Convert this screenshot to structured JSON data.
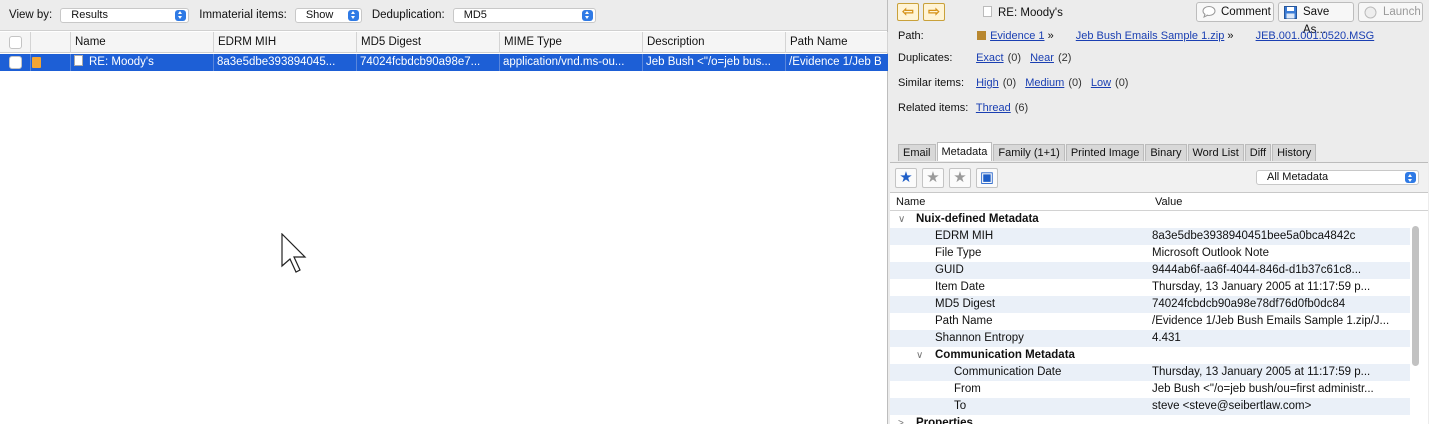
{
  "toolbar": {
    "view_by_label": "View by:",
    "view_by_value": "Results",
    "immaterial_label": "Immaterial items:",
    "immaterial_value": "Show",
    "dedup_label": "Deduplication:",
    "dedup_value": "MD5"
  },
  "results": {
    "columns": [
      "Name",
      "EDRM MIH",
      "MD5 Digest",
      "MIME Type",
      "Description",
      "Path Name"
    ],
    "row": {
      "name": "RE: Moody's",
      "edrm_mih": "8a3e5dbe393894045...",
      "md5": "74024fcbdcb90a98e7...",
      "mime": "application/vnd.ms-ou...",
      "description": "Jeb Bush <\"/o=jeb bus...",
      "path": "/Evidence 1/Jeb B"
    }
  },
  "preview": {
    "title": "RE: Moody's",
    "comment_label": "Comment",
    "save_as_label": "Save As...",
    "launch_label": "Launch",
    "path_label": "Path:",
    "path_items": [
      "Evidence 1",
      "Jeb Bush Emails Sample 1.zip",
      "JEB.001.001.0520.MSG"
    ],
    "path_sep": "»",
    "duplicates_label": "Duplicates:",
    "exact_label": "Exact",
    "exact_count": "(0)",
    "near_label": "Near",
    "near_count": "(2)",
    "similar_label": "Similar items:",
    "high_label": "High",
    "high_count": "(0)",
    "medium_label": "Medium",
    "medium_count": "(0)",
    "low_label": "Low",
    "low_count": "(0)",
    "related_label": "Related items:",
    "thread_label": "Thread",
    "thread_count": "(6)",
    "tabs": [
      "Email",
      "Metadata",
      "Family (1+1)",
      "Printed Image",
      "Binary",
      "Word List",
      "Diff",
      "History"
    ],
    "active_tab": "Metadata",
    "metadata_filter": "All Metadata",
    "meta_headers": {
      "name": "Name",
      "value": "Value"
    },
    "group1": "Nuix-defined Metadata",
    "group2": "Communication Metadata",
    "group3": "Properties",
    "rows": [
      {
        "k": "EDRM MIH",
        "v": "8a3e5dbe3938940451bee5a0bca4842c"
      },
      {
        "k": "File Type",
        "v": "Microsoft Outlook Note"
      },
      {
        "k": "GUID",
        "v": "9444ab6f-aa6f-4044-846d-d1b37c61c8..."
      },
      {
        "k": "Item Date",
        "v": "Thursday, 13 January 2005 at 11:17:59 p..."
      },
      {
        "k": "MD5 Digest",
        "v": "74024fcbdcb90a98e78df76d0fb0dc84"
      },
      {
        "k": "Path Name",
        "v": "/Evidence 1/Jeb Bush Emails Sample 1.zip/J..."
      },
      {
        "k": "Shannon Entropy",
        "v": "4.431"
      }
    ],
    "comm_rows": [
      {
        "k": "Communication Date",
        "v": "Thursday, 13 January 2005 at 11:17:59 p..."
      },
      {
        "k": "From",
        "v": "Jeb Bush <\"/o=jeb bush/ou=first administr..."
      },
      {
        "k": "To",
        "v": "steve <steve@seibertlaw.com>"
      }
    ]
  }
}
